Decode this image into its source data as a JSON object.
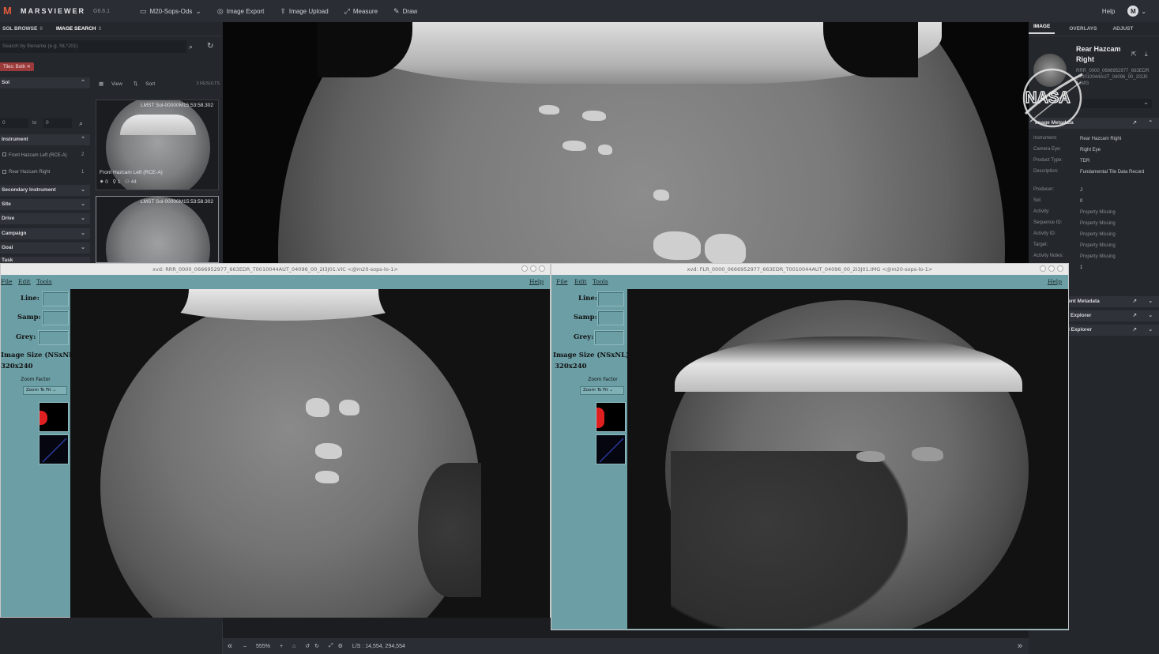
{
  "app": {
    "logo": "M",
    "name": "MARSVIEWER",
    "version": "G6.6.1"
  },
  "toolbar": {
    "dataset": "M20-Sops-Ods",
    "image_export": "Image Export",
    "image_upload": "Image Upload",
    "measure": "Measure",
    "draw": "Draw",
    "help": "Help",
    "user_initial": "M"
  },
  "left": {
    "tabs": [
      {
        "label": "SOL BROWSE",
        "count": "0"
      },
      {
        "label": "IMAGE SEARCH",
        "count": "3"
      }
    ],
    "search_placeholder": "Search by filename (e.g. NL*J01)",
    "chip": "Tiles: Both",
    "filters": {
      "sol": "Sol",
      "range_from": "0",
      "range_to_label": "to",
      "range_to": "0",
      "instrument": "Instrument",
      "inst_items": [
        {
          "label": "Front Hazcam Left (RCE-A)",
          "count": "2"
        },
        {
          "label": "Rear Hazcam Right",
          "count": "1"
        }
      ],
      "secondary": "Secondary Instrument",
      "site": "Site",
      "drive": "Drive",
      "campaign": "Campaign",
      "goal": "Goal",
      "task": "Task"
    },
    "results": {
      "view": "View",
      "sort": "Sort",
      "count": "3 RESULTS"
    },
    "thumbs": [
      {
        "lmst": "LMST Sol-00000M15:53:58.302",
        "label": "Front Hazcam Left (RCE-A)",
        "s1": "0",
        "s2": "1",
        "s3": "44"
      },
      {
        "lmst": "LMST Sol-00000M15:53:58.302"
      }
    ]
  },
  "right": {
    "tabs": [
      "IMAGE",
      "OVERLAYS",
      "ADJUST"
    ],
    "title": "Rear Hazcam Right",
    "filename": "RRR_0000_0666952977_663EDR_T0010044AUT_04096_00_2I3J01.IMG",
    "sections": {
      "metadata": "Image Metadata",
      "s2": "ent Metadata",
      "s3": "Explorer",
      "s4": "l Explorer"
    },
    "metadata": [
      {
        "k": "Instrument:",
        "v": "Rear Hazcam Right"
      },
      {
        "k": "Camera Eye:",
        "v": "Right Eye"
      },
      {
        "k": "Product Type:",
        "v": "TDR"
      },
      {
        "k": "Description:",
        "v": "Fundamental Tile Data Record"
      },
      {
        "k": "Producer:",
        "v": "J"
      },
      {
        "k": "Sol:",
        "v": "0"
      },
      {
        "k": "Activity:",
        "v": "Property Missing"
      },
      {
        "k": "Sequence ID:",
        "v": "Property Missing"
      },
      {
        "k": "Activity ID:",
        "v": "Property Missing"
      },
      {
        "k": "Target:",
        "v": "Property Missing"
      },
      {
        "k": "Activity Notes:",
        "v": "Property Missing"
      },
      {
        "k": "",
        "v": "1"
      }
    ]
  },
  "xvd1": {
    "title": "xvd: RRR_0000_0666952977_663EDR_T0010044AUT_04096_00_2I3J01.VIC <@m20-sops-lo-1>",
    "menu": {
      "file": "File",
      "edit": "Edit",
      "tools": "Tools",
      "help": "Help"
    },
    "line": "Line:",
    "samp": "Samp:",
    "grey": "Grey:",
    "size_label": "Image Size (NSxNL):",
    "size": "320x240",
    "zoom_label": "Zoom Factor",
    "zoom_btn": "Zoom To Fit"
  },
  "xvd2": {
    "title": "xvd: FLR_0000_0666952977_663EDR_T0010044AUT_04096_00_2I3J01.IMG <@m20-sops-lo-1>",
    "menu": {
      "file": "File",
      "edit": "Edit",
      "tools": "Tools",
      "help": "Help"
    },
    "line": "Line:",
    "samp": "Samp:",
    "grey": "Grey:",
    "size_label": "Image Size (NSxNL):",
    "size": "320x240",
    "zoom_label": "Zoom Factor",
    "zoom_btn": "Zoom To Fit"
  },
  "bottom": {
    "first": "«",
    "minus": "–",
    "zoom": "555%",
    "plus": "+",
    "coords": "L/S : 14,554, 294,554",
    "last": "»"
  },
  "overlay": {
    "nasa": "NASA"
  }
}
